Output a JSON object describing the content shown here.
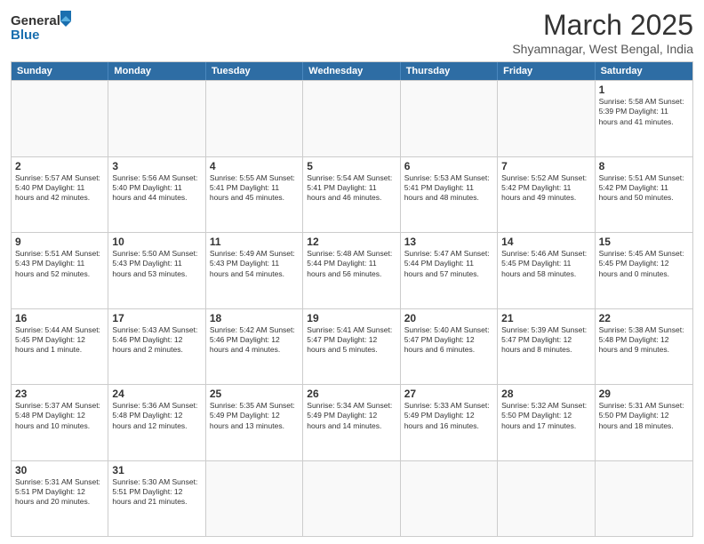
{
  "header": {
    "logo_general": "General",
    "logo_blue": "Blue",
    "month_title": "March 2025",
    "subtitle": "Shyamnagar, West Bengal, India"
  },
  "weekdays": [
    "Sunday",
    "Monday",
    "Tuesday",
    "Wednesday",
    "Thursday",
    "Friday",
    "Saturday"
  ],
  "rows": [
    [
      {
        "day": "",
        "info": ""
      },
      {
        "day": "",
        "info": ""
      },
      {
        "day": "",
        "info": ""
      },
      {
        "day": "",
        "info": ""
      },
      {
        "day": "",
        "info": ""
      },
      {
        "day": "",
        "info": ""
      },
      {
        "day": "1",
        "info": "Sunrise: 5:58 AM\nSunset: 5:39 PM\nDaylight: 11 hours\nand 41 minutes."
      }
    ],
    [
      {
        "day": "2",
        "info": "Sunrise: 5:57 AM\nSunset: 5:40 PM\nDaylight: 11 hours\nand 42 minutes."
      },
      {
        "day": "3",
        "info": "Sunrise: 5:56 AM\nSunset: 5:40 PM\nDaylight: 11 hours\nand 44 minutes."
      },
      {
        "day": "4",
        "info": "Sunrise: 5:55 AM\nSunset: 5:41 PM\nDaylight: 11 hours\nand 45 minutes."
      },
      {
        "day": "5",
        "info": "Sunrise: 5:54 AM\nSunset: 5:41 PM\nDaylight: 11 hours\nand 46 minutes."
      },
      {
        "day": "6",
        "info": "Sunrise: 5:53 AM\nSunset: 5:41 PM\nDaylight: 11 hours\nand 48 minutes."
      },
      {
        "day": "7",
        "info": "Sunrise: 5:52 AM\nSunset: 5:42 PM\nDaylight: 11 hours\nand 49 minutes."
      },
      {
        "day": "8",
        "info": "Sunrise: 5:51 AM\nSunset: 5:42 PM\nDaylight: 11 hours\nand 50 minutes."
      }
    ],
    [
      {
        "day": "9",
        "info": "Sunrise: 5:51 AM\nSunset: 5:43 PM\nDaylight: 11 hours\nand 52 minutes."
      },
      {
        "day": "10",
        "info": "Sunrise: 5:50 AM\nSunset: 5:43 PM\nDaylight: 11 hours\nand 53 minutes."
      },
      {
        "day": "11",
        "info": "Sunrise: 5:49 AM\nSunset: 5:43 PM\nDaylight: 11 hours\nand 54 minutes."
      },
      {
        "day": "12",
        "info": "Sunrise: 5:48 AM\nSunset: 5:44 PM\nDaylight: 11 hours\nand 56 minutes."
      },
      {
        "day": "13",
        "info": "Sunrise: 5:47 AM\nSunset: 5:44 PM\nDaylight: 11 hours\nand 57 minutes."
      },
      {
        "day": "14",
        "info": "Sunrise: 5:46 AM\nSunset: 5:45 PM\nDaylight: 11 hours\nand 58 minutes."
      },
      {
        "day": "15",
        "info": "Sunrise: 5:45 AM\nSunset: 5:45 PM\nDaylight: 12 hours\nand 0 minutes."
      }
    ],
    [
      {
        "day": "16",
        "info": "Sunrise: 5:44 AM\nSunset: 5:45 PM\nDaylight: 12 hours\nand 1 minute."
      },
      {
        "day": "17",
        "info": "Sunrise: 5:43 AM\nSunset: 5:46 PM\nDaylight: 12 hours\nand 2 minutes."
      },
      {
        "day": "18",
        "info": "Sunrise: 5:42 AM\nSunset: 5:46 PM\nDaylight: 12 hours\nand 4 minutes."
      },
      {
        "day": "19",
        "info": "Sunrise: 5:41 AM\nSunset: 5:47 PM\nDaylight: 12 hours\nand 5 minutes."
      },
      {
        "day": "20",
        "info": "Sunrise: 5:40 AM\nSunset: 5:47 PM\nDaylight: 12 hours\nand 6 minutes."
      },
      {
        "day": "21",
        "info": "Sunrise: 5:39 AM\nSunset: 5:47 PM\nDaylight: 12 hours\nand 8 minutes."
      },
      {
        "day": "22",
        "info": "Sunrise: 5:38 AM\nSunset: 5:48 PM\nDaylight: 12 hours\nand 9 minutes."
      }
    ],
    [
      {
        "day": "23",
        "info": "Sunrise: 5:37 AM\nSunset: 5:48 PM\nDaylight: 12 hours\nand 10 minutes."
      },
      {
        "day": "24",
        "info": "Sunrise: 5:36 AM\nSunset: 5:48 PM\nDaylight: 12 hours\nand 12 minutes."
      },
      {
        "day": "25",
        "info": "Sunrise: 5:35 AM\nSunset: 5:49 PM\nDaylight: 12 hours\nand 13 minutes."
      },
      {
        "day": "26",
        "info": "Sunrise: 5:34 AM\nSunset: 5:49 PM\nDaylight: 12 hours\nand 14 minutes."
      },
      {
        "day": "27",
        "info": "Sunrise: 5:33 AM\nSunset: 5:49 PM\nDaylight: 12 hours\nand 16 minutes."
      },
      {
        "day": "28",
        "info": "Sunrise: 5:32 AM\nSunset: 5:50 PM\nDaylight: 12 hours\nand 17 minutes."
      },
      {
        "day": "29",
        "info": "Sunrise: 5:31 AM\nSunset: 5:50 PM\nDaylight: 12 hours\nand 18 minutes."
      }
    ],
    [
      {
        "day": "30",
        "info": "Sunrise: 5:31 AM\nSunset: 5:51 PM\nDaylight: 12 hours\nand 20 minutes."
      },
      {
        "day": "31",
        "info": "Sunrise: 5:30 AM\nSunset: 5:51 PM\nDaylight: 12 hours\nand 21 minutes."
      },
      {
        "day": "",
        "info": ""
      },
      {
        "day": "",
        "info": ""
      },
      {
        "day": "",
        "info": ""
      },
      {
        "day": "",
        "info": ""
      },
      {
        "day": "",
        "info": ""
      }
    ]
  ]
}
